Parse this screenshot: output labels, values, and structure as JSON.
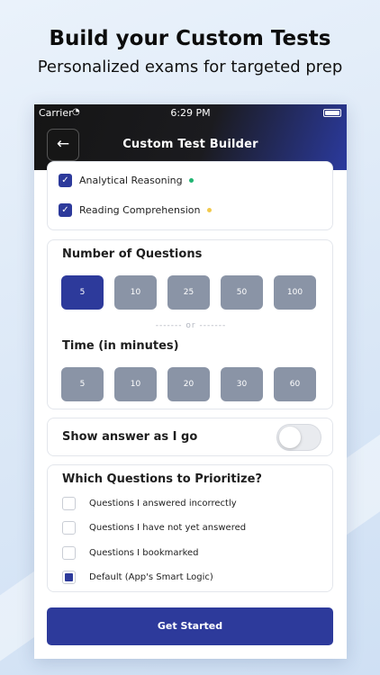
{
  "promo": {
    "title": "Build your Custom Tests",
    "subtitle": "Personalized exams for targeted prep"
  },
  "status_bar": {
    "carrier": "Carrier",
    "time": "6:29 PM"
  },
  "nav": {
    "back_icon": "back-arrow-icon",
    "title": "Custom Test Builder"
  },
  "subjects": [
    {
      "label": "Analytical Reasoning",
      "checked": true,
      "dot_color": "#22b573"
    },
    {
      "label": "Reading Comprehension",
      "checked": true,
      "dot_color": "#f2c94c"
    }
  ],
  "questions": {
    "title": "Number of Questions",
    "options": [
      "5",
      "10",
      "25",
      "50",
      "100"
    ],
    "selected": "5"
  },
  "divider_text": "------- or -------",
  "time": {
    "title": "Time (in minutes)",
    "options": [
      "5",
      "10",
      "20",
      "30",
      "60"
    ]
  },
  "show_answer": {
    "label": "Show answer as I go",
    "enabled": false
  },
  "prioritize": {
    "title": "Which Questions to Prioritize?",
    "options": [
      {
        "label": "Questions I answered incorrectly",
        "checked": false
      },
      {
        "label": "Questions I have not yet answered",
        "checked": false
      },
      {
        "label": "Questions I bookmarked",
        "checked": false
      },
      {
        "label": "Default (App's Smart Logic)",
        "checked": true
      }
    ]
  },
  "cta": {
    "label": "Get Started"
  },
  "colors": {
    "accent": "#2d3a9b",
    "inactive_option": "#8a94a6"
  }
}
